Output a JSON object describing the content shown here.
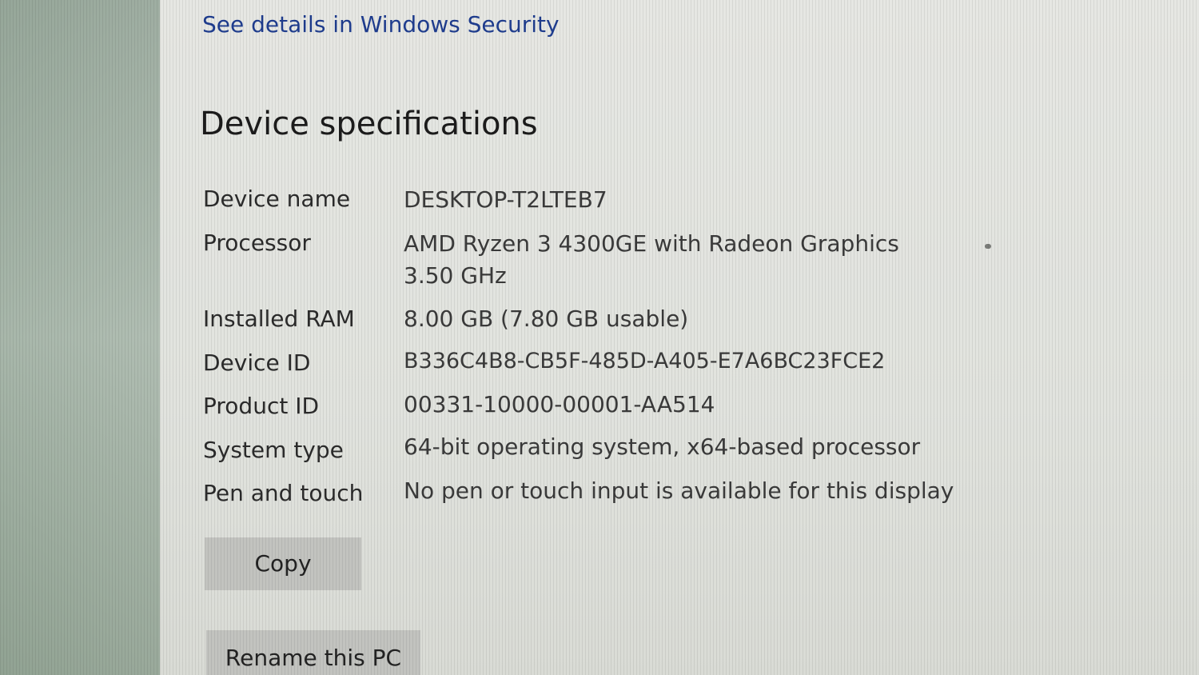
{
  "security": {
    "link_text": "See details in Windows Security"
  },
  "specs": {
    "title": "Device specifications",
    "rows": [
      {
        "label": "Device name",
        "value": "DESKTOP-T2LTEB7"
      },
      {
        "label": "Processor",
        "value": "AMD Ryzen 3 4300GE with Radeon Graphics   3.50 GHz"
      },
      {
        "label": "Installed RAM",
        "value": "8.00 GB (7.80 GB usable)"
      },
      {
        "label": "Device ID",
        "value": "B336C4B8-CB5F-485D-A405-E7A6BC23FCE2"
      },
      {
        "label": "Product ID",
        "value": "00331-10000-00001-AA514"
      },
      {
        "label": "System type",
        "value": "64-bit operating system, x64-based processor"
      },
      {
        "label": "Pen and touch",
        "value": "No pen or touch input is available for this display"
      }
    ],
    "copy_label": "Copy",
    "rename_label": "Rename this PC"
  },
  "colors": {
    "link": "#1f3d8f",
    "button_bg": "#c2c3bf",
    "panel_bg": "#e3e5e0"
  }
}
